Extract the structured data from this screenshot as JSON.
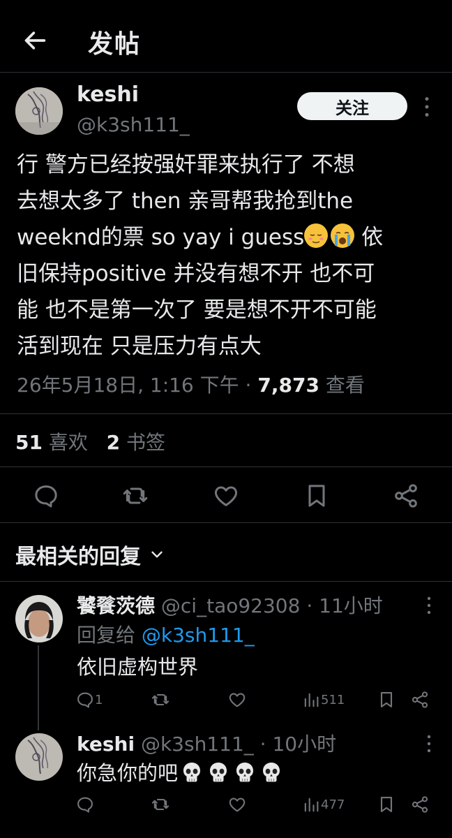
{
  "header": {
    "title": "发帖"
  },
  "post": {
    "author_name": "keshi",
    "author_handle": "@k3sh111_",
    "follow_label": "关注",
    "lines": [
      "行 警方已经按强奸罪来执行了 不想",
      "去想太多了 then 亲哥帮我抢到the",
      "weeknd的票 so yay i guess",
      " 依",
      "旧保持positive 并没有想不开 也不可",
      "能 也不是第一次了 要是想不开不可能",
      "活到现在 只是压力有点大"
    ],
    "date": "26年5月18日, 1:16 下午 · ",
    "views": "7,873",
    "views_label": " 查看",
    "likes": "51",
    "likes_label": " 喜欢",
    "bookmarks": "2",
    "bookmarks_label": " 书签"
  },
  "sort_label": "最相关的回复",
  "replies": [
    {
      "name": "饕餮茨德",
      "meta": " @ci_tao92308 · 11小时",
      "reply_to_label": "回复给 ",
      "reply_to_handle": "@k3sh111_",
      "text": "依旧虚构世界",
      "reply_count": "1",
      "views": "511"
    },
    {
      "name": "keshi",
      "meta": " @k3sh111_ · 10小时",
      "text": "你急你的吧",
      "views": "477"
    }
  ],
  "icons": {
    "back": "arrow-left-icon",
    "more": "more-vertical-icon",
    "reply": "reply-icon",
    "retweet": "retweet-icon",
    "like": "heart-icon",
    "bookmark": "bookmark-icon",
    "share": "share-icon",
    "views": "bar-chart-icon",
    "chevron": "chevron-down-icon",
    "emoji_relieved": "relieved-face-emoji",
    "emoji_cry": "loudly-crying-face-emoji",
    "emoji_skull": "skull-emoji"
  },
  "colors": {
    "background": "#000000",
    "text": "#e7e9ea",
    "muted": "#71767b",
    "link": "#1d9bf0",
    "divider": "#2f3336"
  }
}
